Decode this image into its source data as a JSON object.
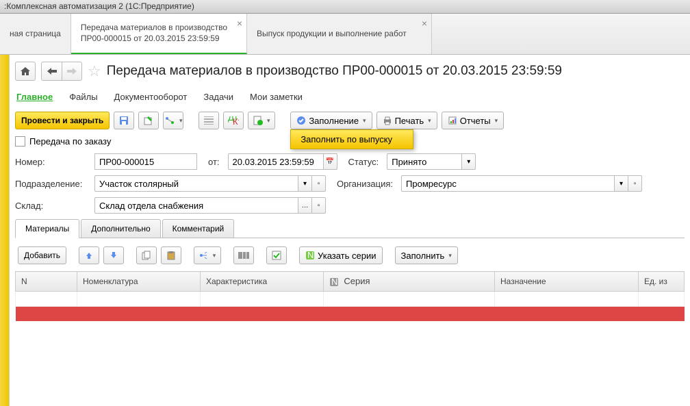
{
  "window_title": ":Комплексная автоматизация 2 (1С:Предприятие)",
  "tabs": [
    {
      "label": "ная страница"
    },
    {
      "label": "Передача материалов в производство\nПР00-000015 от 20.03.2015 23:59:59"
    },
    {
      "label": "Выпуск продукции и выполнение работ"
    }
  ],
  "page_title": "Передача материалов в производство ПР00-000015 от 20.03.2015 23:59:59",
  "subnav": {
    "main": "Главное",
    "files": "Файлы",
    "docflow": "Документооборот",
    "tasks": "Задачи",
    "notes": "Мои заметки"
  },
  "toolbar": {
    "post_close": "Провести и закрыть",
    "fill": "Заполнение",
    "print": "Печать",
    "reports": "Отчеты"
  },
  "fill_menu": {
    "item1": "Заполнить по выпуску"
  },
  "check": {
    "by_order": "Передача по заказу"
  },
  "form": {
    "number_lbl": "Номер:",
    "number_val": "ПР00-000015",
    "from_lbl": "от:",
    "date_val": "20.03.2015 23:59:59",
    "status_lbl": "Статус:",
    "status_val": "Принято",
    "dept_lbl": "Подразделение:",
    "dept_val": "Участок столярный",
    "org_lbl": "Организация:",
    "org_val": "Промресурс",
    "wh_lbl": "Склад:",
    "wh_val": "Склад отдела снабжения"
  },
  "tabs2": {
    "mat": "Материалы",
    "add": "Дополнительно",
    "com": "Комментарий"
  },
  "toolbar2": {
    "add": "Добавить",
    "series": "Указать серии",
    "fill": "Заполнить"
  },
  "cols": {
    "n": "N",
    "item": "Номенклатура",
    "char": "Характеристика",
    "series": "Серия",
    "dest": "Назначение",
    "unit": "Ед. из"
  }
}
